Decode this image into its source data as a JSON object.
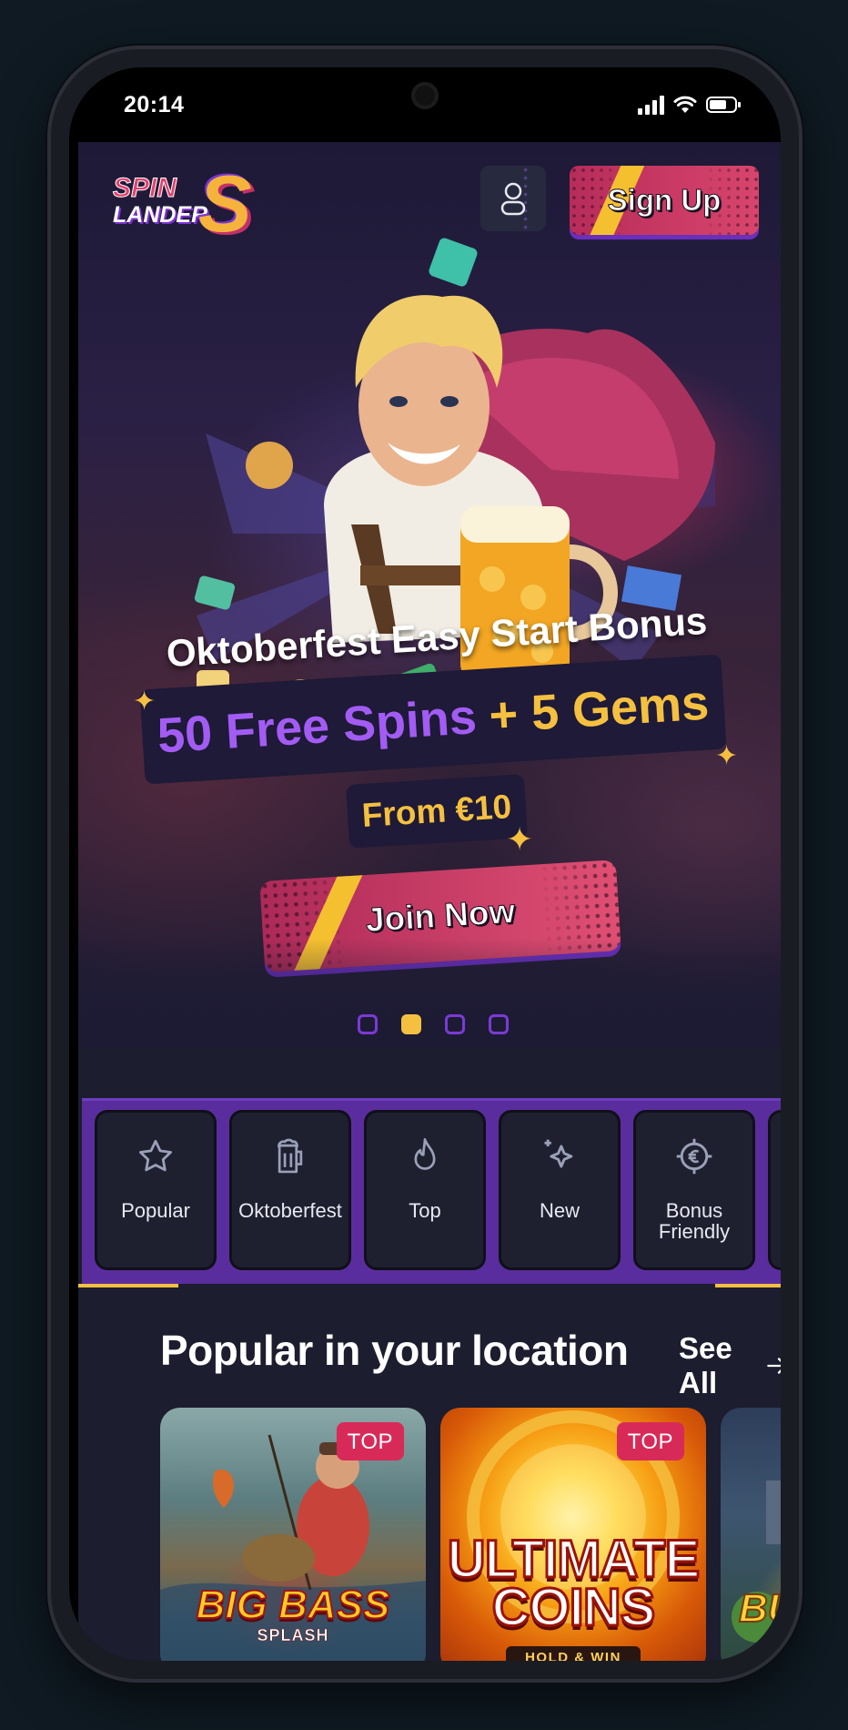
{
  "status_bar": {
    "time": "20:14"
  },
  "header": {
    "logo_line1": "SPIN",
    "logo_line2": "LANDER",
    "logo_mark": "S",
    "signup_label": "Sign Up",
    "user_icon": "user-icon"
  },
  "hero": {
    "title": "Oktoberfest Easy Start Bonus",
    "promo_spins": "50 Free Spins",
    "promo_gems": "+ 5 Gems",
    "min_deposit": "From €10",
    "cta_label": "Join Now",
    "carousel_total": 4,
    "carousel_active": 2
  },
  "categories": [
    {
      "label": "Popular",
      "icon": "star-icon"
    },
    {
      "label": "Oktoberfest",
      "icon": "beer-mug-icon"
    },
    {
      "label": "Top",
      "icon": "flame-icon"
    },
    {
      "label": "New",
      "icon": "sparkles-icon"
    },
    {
      "label": "Bonus Friendly",
      "icon": "euro-coin-icon"
    }
  ],
  "popular": {
    "title": "Popular in your location",
    "see_all": "See All",
    "games": [
      {
        "name": "BIG BASS",
        "subtitle": "SPLASH",
        "badge": "TOP"
      },
      {
        "name": "ULTIMATE COINS",
        "subtitle": "HOLD & WIN",
        "badge": "TOP"
      },
      {
        "name": "BUI BU"
      }
    ]
  },
  "colors": {
    "accent_pink": "#d8456c",
    "accent_purple": "#a35cf3",
    "accent_yellow": "#f5c040",
    "band_purple": "#5a2d9e",
    "background": "#1c1d2e"
  }
}
